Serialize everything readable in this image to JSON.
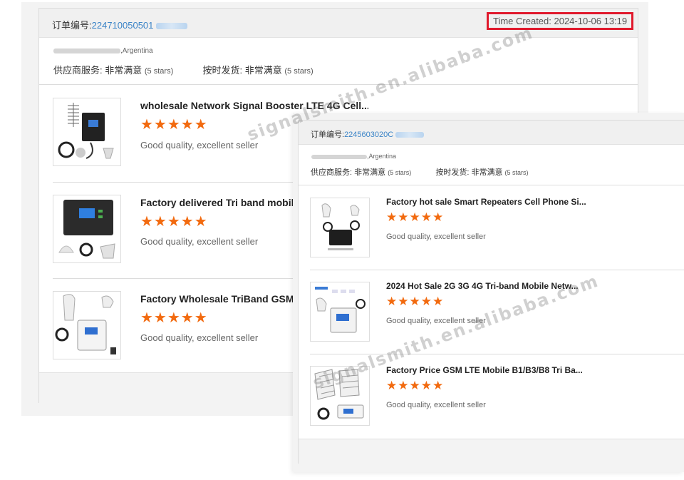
{
  "card1": {
    "order_prefix": "订单编号:",
    "order_number": "224710050501",
    "time_created": "Time Created: 2024-10-06 13:19",
    "address_suffix": ",Argentina",
    "supplier_service_label": "供应商服务:",
    "supplier_service_value": "非常满意",
    "supplier_service_stars": "(5 stars)",
    "on_time_label": "按时发货:",
    "on_time_value": "非常满意",
    "on_time_stars": "(5 stars)",
    "items": [
      {
        "title": "wholesale Network Signal Booster LTE 4G Cell...",
        "stars": "★★★★★",
        "review": "Good quality, excellent seller"
      },
      {
        "title": "Factory delivered Tri band mobil",
        "stars": "★★★★★",
        "review": "Good quality, excellent seller"
      },
      {
        "title": "Factory Wholesale TriBand GSM",
        "stars": "★★★★★",
        "review": "Good quality, excellent seller"
      }
    ]
  },
  "card2": {
    "order_prefix": "订单编号:",
    "order_number": "2245603020C",
    "address_suffix": ",Argentina",
    "supplier_service_label": "供应商服务:",
    "supplier_service_value": "非常满意",
    "supplier_service_stars": "(5 stars)",
    "on_time_label": "按时发货:",
    "on_time_value": "非常满意",
    "on_time_stars": "(5 stars)",
    "items": [
      {
        "title": "Factory hot sale Smart Repeaters Cell Phone Si...",
        "stars": "★★★★★",
        "review": "Good quality, excellent seller"
      },
      {
        "title": "2024 Hot Sale 2G 3G 4G Tri-band Mobile Netw...",
        "stars": "★★★★★",
        "review": "Good quality, excellent seller"
      },
      {
        "title": "Factory Price GSM LTE Mobile B1/B3/B8 Tri Ba...",
        "stars": "★★★★★",
        "review": "Good quality, excellent seller"
      }
    ]
  },
  "watermarks": {
    "top": "signalsmith.en.alibaba.com",
    "bottom": "signalsmith.en.alibaba.com"
  },
  "colors": {
    "star": "#f26a0f",
    "order_number": "#3b84c7",
    "highlight_border": "#e0192c"
  }
}
